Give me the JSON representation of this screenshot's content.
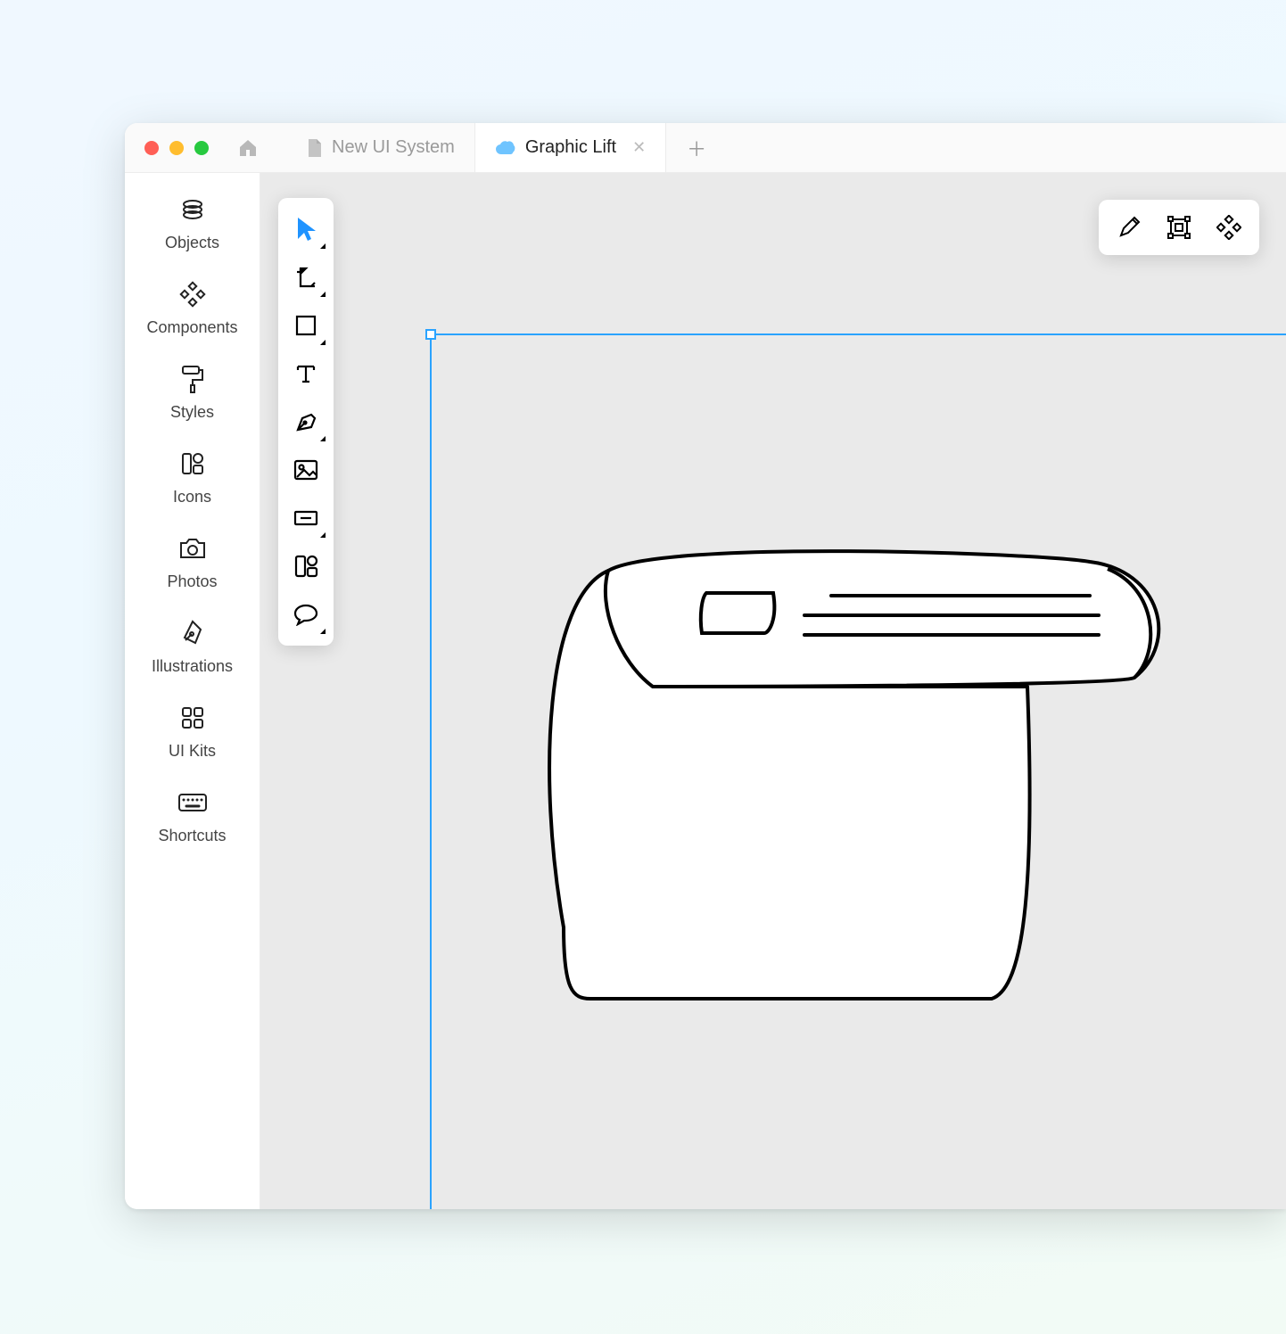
{
  "tabs": {
    "inactive_label": "New UI System",
    "active_label": "Graphic Lift"
  },
  "sidebar": {
    "items": [
      {
        "label": "Objects"
      },
      {
        "label": "Components"
      },
      {
        "label": "Styles"
      },
      {
        "label": "Icons"
      },
      {
        "label": "Photos"
      },
      {
        "label": "Illustrations"
      },
      {
        "label": "UI Kits"
      },
      {
        "label": "Shortcuts"
      }
    ]
  },
  "vtoolbar": {
    "items": [
      "select-tool",
      "artboard-tool",
      "rectangle-tool",
      "text-tool",
      "pen-tool",
      "image-tool",
      "button-tool",
      "component-tool",
      "comment-tool"
    ]
  },
  "htoolbar": {
    "items": [
      "pencil-tool",
      "transform-tool",
      "components-tool"
    ]
  }
}
